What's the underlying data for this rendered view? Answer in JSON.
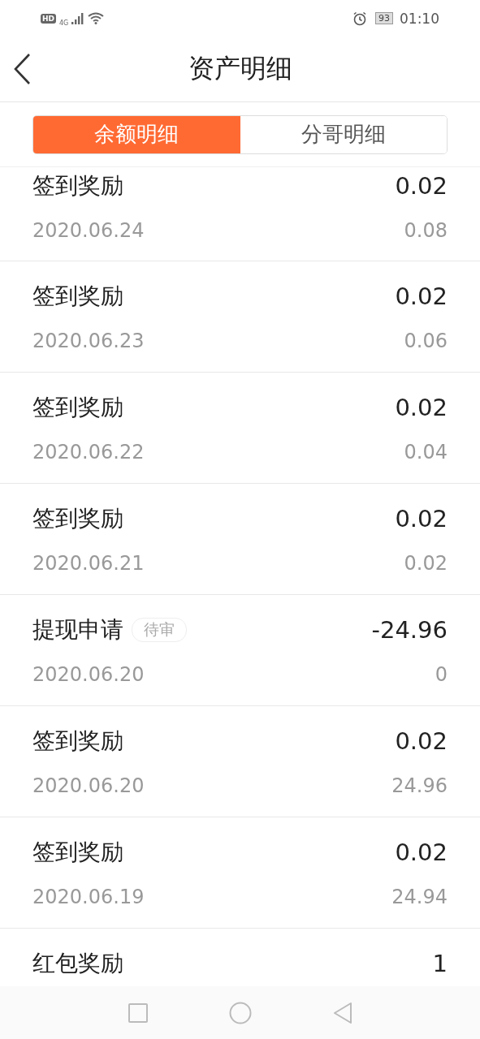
{
  "status_bar": {
    "hd": "HD",
    "network": "4G",
    "battery": "93",
    "time": "01:10"
  },
  "header": {
    "title": "资产明细"
  },
  "tabs": [
    {
      "label": "余额明细",
      "selected": true
    },
    {
      "label": "分哥明细",
      "selected": false
    }
  ],
  "records": [
    {
      "title": "签到奖励",
      "amount": "0.02",
      "date": "2020.06.24",
      "balance": "0.08"
    },
    {
      "title": "签到奖励",
      "amount": "0.02",
      "date": "2020.06.23",
      "balance": "0.06"
    },
    {
      "title": "签到奖励",
      "amount": "0.02",
      "date": "2020.06.22",
      "balance": "0.04"
    },
    {
      "title": "签到奖励",
      "amount": "0.02",
      "date": "2020.06.21",
      "balance": "0.02"
    },
    {
      "title": "提现申请",
      "tag": "待审",
      "amount": "-24.96",
      "date": "2020.06.20",
      "balance": "0"
    },
    {
      "title": "签到奖励",
      "amount": "0.02",
      "date": "2020.06.20",
      "balance": "24.96"
    },
    {
      "title": "签到奖励",
      "amount": "0.02",
      "date": "2020.06.19",
      "balance": "24.94"
    },
    {
      "title": "红包奖励",
      "amount": "1"
    }
  ]
}
